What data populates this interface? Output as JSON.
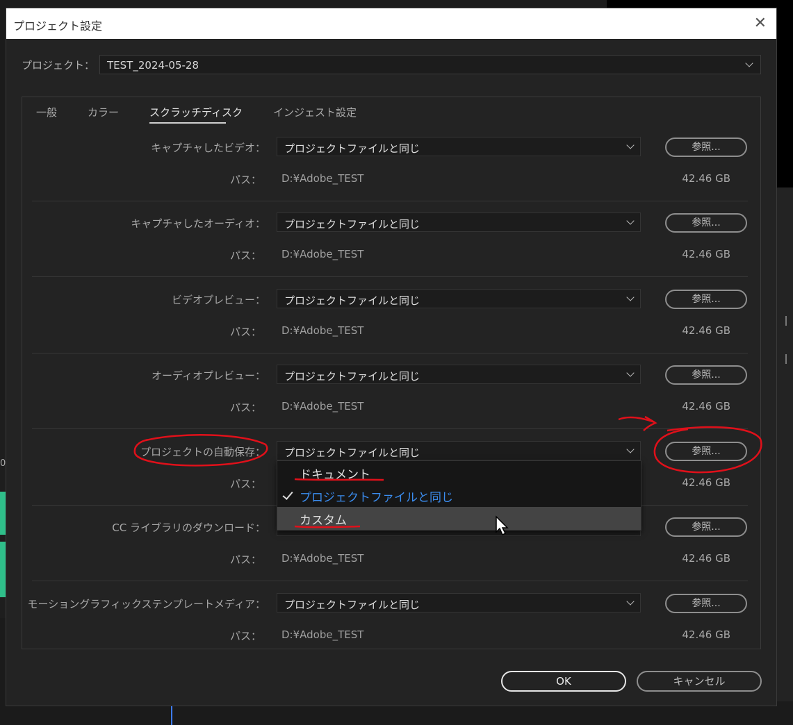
{
  "dialog": {
    "title": "プロジェクト設定",
    "close_symbol": "✕",
    "project_label": "プロジェクト：",
    "project_value": "TEST_2024-05-28"
  },
  "tabs": [
    {
      "label": "一般"
    },
    {
      "label": "カラー"
    },
    {
      "label": "スクラッチディスク"
    },
    {
      "label": "インジェスト設定"
    }
  ],
  "rows": [
    {
      "label": "キャプチャしたビデオ：",
      "select": "プロジェクトファイルと同じ",
      "browse": "参照...",
      "path_label": "パス：",
      "path": "D:¥Adobe_TEST",
      "size": "42.46 GB"
    },
    {
      "label": "キャプチャしたオーディオ：",
      "select": "プロジェクトファイルと同じ",
      "browse": "参照...",
      "path_label": "パス：",
      "path": "D:¥Adobe_TEST",
      "size": "42.46 GB"
    },
    {
      "label": "ビデオプレビュー：",
      "select": "プロジェクトファイルと同じ",
      "browse": "参照...",
      "path_label": "パス：",
      "path": "D:¥Adobe_TEST",
      "size": "42.46 GB"
    },
    {
      "label": "オーディオプレビュー：",
      "select": "プロジェクトファイルと同じ",
      "browse": "参照...",
      "path_label": "パス：",
      "path": "D:¥Adobe_TEST",
      "size": "42.46 GB"
    },
    {
      "label": "プロジェクトの自動保存：",
      "select": "プロジェクトファイルと同じ",
      "browse": "参照...",
      "path_label": "パス：",
      "path": "",
      "size": "42.46 GB"
    },
    {
      "label": "CC ライブラリのダウンロード：",
      "select": "",
      "browse": "参照...",
      "path_label": "パス：",
      "path": "D:¥Adobe_TEST",
      "size": "42.46 GB"
    },
    {
      "label": "モーショングラフィックステンプレートメディア：",
      "select": "プロジェクトファイルと同じ",
      "browse": "参照...",
      "path_label": "パス：",
      "path": "D:¥Adobe_TEST",
      "size": "42.46 GB"
    }
  ],
  "dropdown": {
    "items": [
      {
        "label": "ドキュメント",
        "state": "normal"
      },
      {
        "label": "プロジェクトファイルと同じ",
        "state": "checked"
      },
      {
        "label": "カスタム",
        "state": "hover"
      }
    ]
  },
  "buttons": {
    "ok": "OK",
    "cancel": "キャンセル"
  },
  "background": {
    "timeline_marker": "0"
  },
  "colors": {
    "dialog_bg": "#232323",
    "accent_blue": "#3b8df0",
    "annotation_red": "#e0101a",
    "waveform_green": "#2fbf8a"
  }
}
